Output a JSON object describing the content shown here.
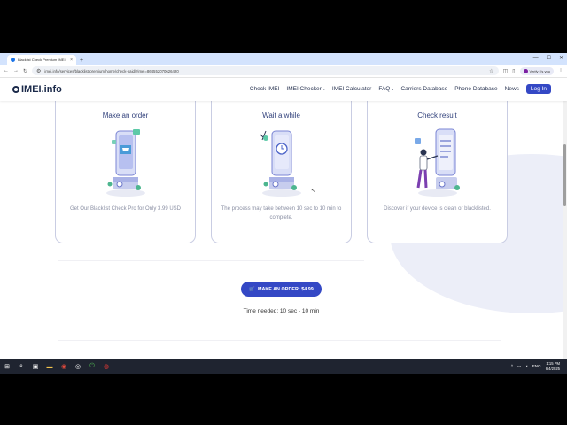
{
  "browser": {
    "tab_title": "Blacklist Check Premium IMEI",
    "tab_close": "×",
    "new_tab": "+",
    "url": "imei.info/services/blacklist-premium/home/check-paid/?imei=864552070626420",
    "profile_label": "Verify it's you",
    "win_min": "—",
    "win_max": "☐",
    "win_close": "✕"
  },
  "header": {
    "logo_text": "IMEI.info",
    "nav": [
      "Check IMEI",
      "IMEI Checker",
      "IMEI Calculator",
      "FAQ",
      "Carriers Database",
      "Phone Database",
      "News"
    ],
    "login": "Log In"
  },
  "cards": [
    {
      "title": "Make an order",
      "desc": "Get Our Blacklist Check Pro for Only 3.99 USD"
    },
    {
      "title": "Wait a while",
      "desc": "The process may take between 10 sec to 10 min to complete."
    },
    {
      "title": "Check result",
      "desc": "Discover if your device is clean or blacklisted."
    }
  ],
  "cta": {
    "label": "MAKE AN ORDER: $4.99",
    "icon": "cart-icon"
  },
  "time_needed": "Time needed: 10 sec - 10 min",
  "taskbar": {
    "lang": "ENG",
    "time": "1:15 PM",
    "date": "6/4/2025"
  },
  "colors": {
    "primary": "#3448c5",
    "title": "#2f3f7a",
    "desc": "#8a8fa3"
  }
}
